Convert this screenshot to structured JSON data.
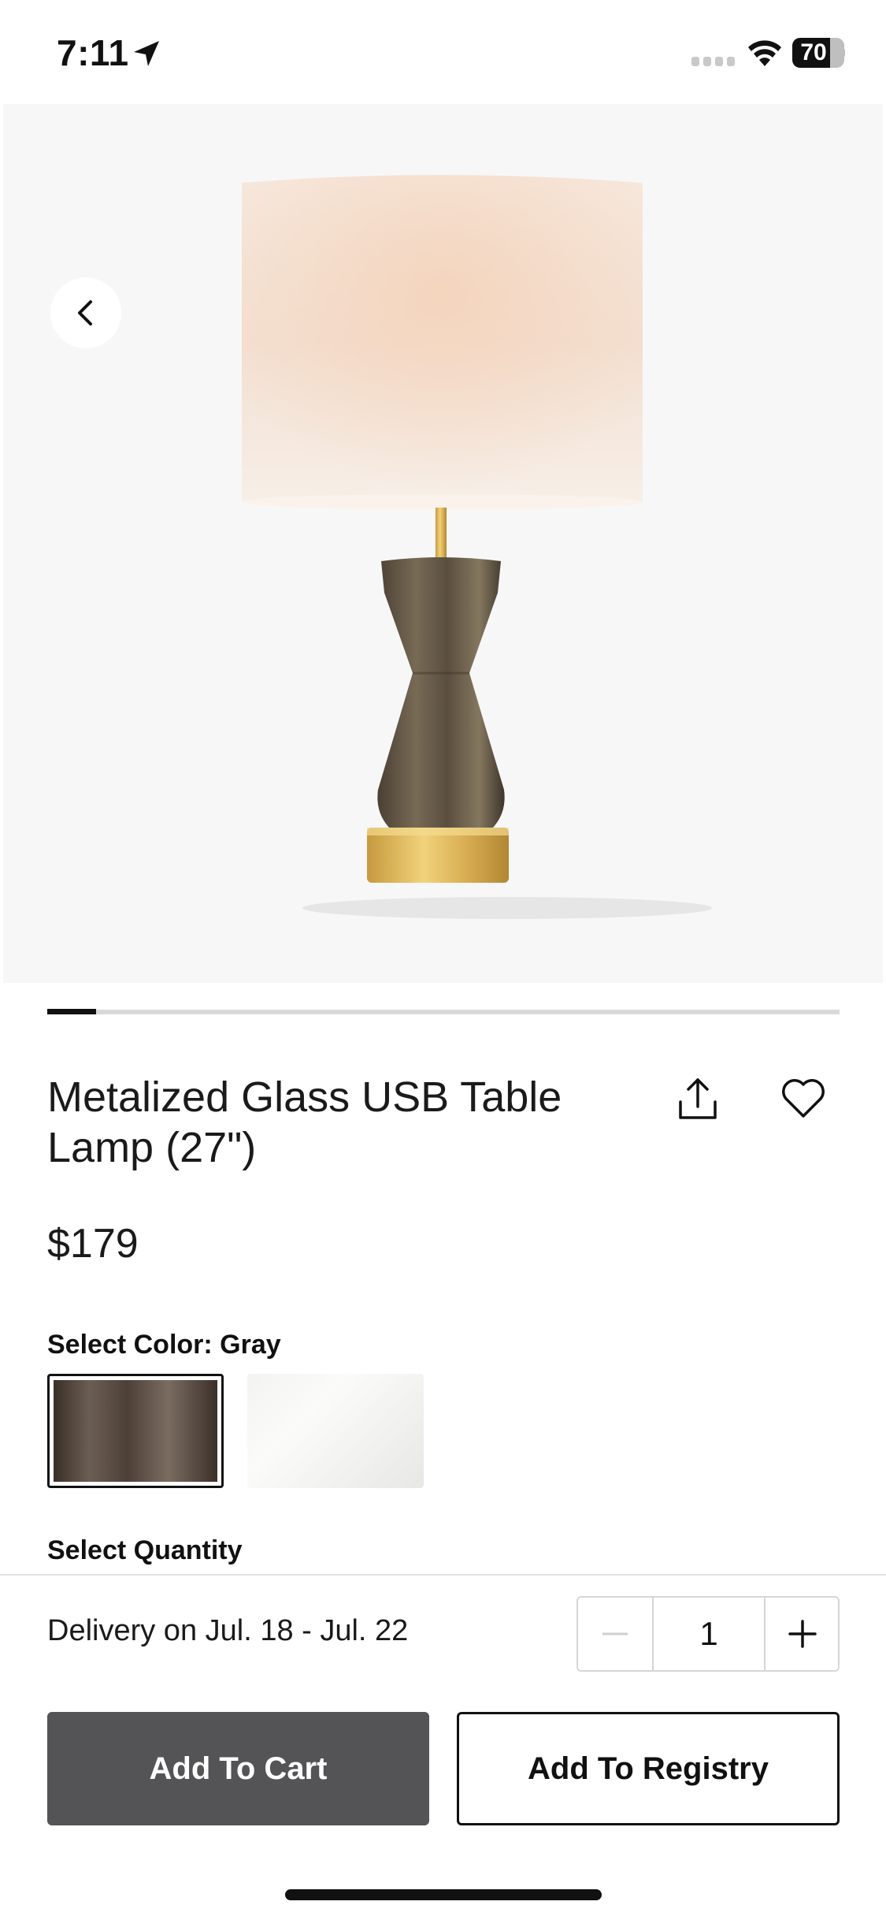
{
  "status_bar": {
    "time": "7:11",
    "battery": "70",
    "icons": [
      "location-arrow-icon",
      "cellular-signal-icon",
      "wifi-icon",
      "battery-icon"
    ]
  },
  "product": {
    "title": "Metalized Glass USB Table Lamp (27\")",
    "price": "$179",
    "image_count_indicator": {
      "current": 1
    },
    "color_label": "Select Color: Gray",
    "color_options": [
      "Gray",
      "White"
    ],
    "selected_color": "Gray",
    "quantity_label": "Select Quantity"
  },
  "purchase": {
    "delivery": "Delivery on Jul. 18 - Jul. 22",
    "quantity": "1",
    "add_to_cart": "Add To Cart",
    "add_to_registry": "Add To Registry"
  },
  "icons": {
    "back": "chevron-left-icon",
    "share": "share-icon",
    "favorite": "heart-icon",
    "minus": "minus-icon",
    "plus": "plus-icon"
  },
  "colors": {
    "primary_button": "#545456",
    "text": "#111111",
    "hero_background": "#f7f7f8"
  }
}
